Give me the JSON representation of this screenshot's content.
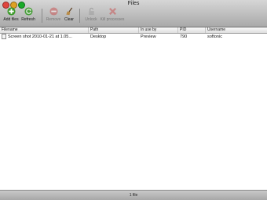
{
  "window": {
    "title": "Files"
  },
  "toolbar": {
    "add_files": "Add files",
    "refresh": "Refresh",
    "remove": "Remove",
    "clear": "Clear",
    "unlock": "Unlock",
    "kill_processes": "Kill processes"
  },
  "table": {
    "headers": [
      "Filename",
      "Path",
      "In use by",
      "PID",
      "Username"
    ],
    "rows": [
      {
        "filename": "Screen shot 2010-01-21 at 1.05...",
        "path": "Desktop",
        "in_use_by": "Preview",
        "pid": "790",
        "username": "softonic"
      }
    ]
  },
  "status": {
    "count": "1 file"
  },
  "colors": {
    "close": "#e0443e",
    "minimize": "#dea123",
    "maximize": "#1aab29",
    "add": "#3c9a2a",
    "remove": "#c94c4c"
  },
  "icons": [
    "plus-icon",
    "refresh-icon",
    "remove-icon",
    "broom-icon",
    "unlock-icon",
    "kill-icon",
    "file-icon"
  ]
}
